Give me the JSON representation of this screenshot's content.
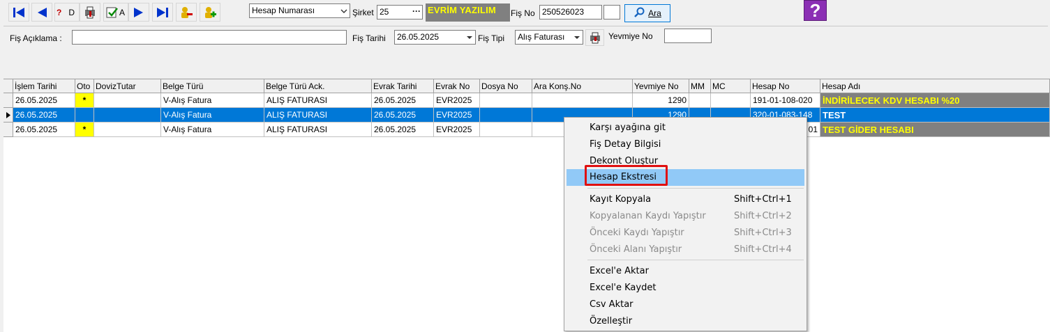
{
  "toolbar": {
    "icons": [
      "first-icon",
      "prev-icon",
      "query-icon",
      "print-preview-icon",
      "refresh-icon",
      "next-icon",
      "last-icon",
      "delete-user-icon",
      "add-user-icon"
    ],
    "partial_label_1": "D",
    "partial_label_2": "A"
  },
  "search": {
    "account_type": "Hesap Numarası",
    "company_label": "Şirket",
    "company_code": "25",
    "company_more": "···",
    "company_name": "EVRİM YAZILIM",
    "voucher_label": "Fiş No",
    "voucher_no": "250526023",
    "voucher_extra": "",
    "search_button": "Ara"
  },
  "form": {
    "description_label": "Fiş Açıklama :",
    "description_value": "",
    "date_label": "Fiş Tarihi",
    "date_value": "26.05.2025",
    "type_label": "Fiş  Tipi",
    "type_value": "Alış Faturası",
    "journal_label": "Yevmiye No",
    "journal_value": ""
  },
  "grid": {
    "columns": [
      "İşlem Tarihi",
      "Oto",
      "DovizTutar",
      "Belge Türü",
      "Belge Türü Ack.",
      "Evrak Tarihi",
      "Evrak No",
      "Dosya No",
      "Ara Konş.No",
      "Yevmiye No",
      "MM",
      "MC",
      "Hesap No",
      "Hesap Adı"
    ],
    "rows": [
      {
        "islem_tarihi": "26.05.2025",
        "oto": "*",
        "doviz": "",
        "belge_turu": "V-Alış Fatura",
        "belge_ack": "ALIŞ FATURASI",
        "evrak_tarihi": "26.05.2025",
        "evrak_no": "EVR2025",
        "dosya_no": "",
        "ara_kons": "",
        "yevmiye": "1290",
        "mm": "",
        "mc": "",
        "hesap_no": "191-01-108-020",
        "hesap_adi": "İNDİRİLECEK KDV HESABI %20"
      },
      {
        "islem_tarihi": "26.05.2025",
        "oto": "",
        "doviz": "",
        "belge_turu": "V-Alış Fatura",
        "belge_ack": "ALIŞ FATURASI",
        "evrak_tarihi": "26.05.2025",
        "evrak_no": "EVR2025",
        "dosya_no": "",
        "ara_kons": "",
        "yevmiye": "1290",
        "mm": "",
        "mc": "",
        "hesap_no": "320-01-083-148",
        "hesap_adi": "TEST"
      },
      {
        "islem_tarihi": "26.05.2025",
        "oto": "*",
        "doviz": "",
        "belge_turu": "V-Alış Fatura",
        "belge_ack": "ALIŞ FATURASI",
        "evrak_tarihi": "26.05.2025",
        "evrak_no": "EVR2025",
        "dosya_no": "",
        "ara_kons": "",
        "yevmiye": "",
        "mm": "",
        "mc": "",
        "hesap_no": "01",
        "hesap_adi": "TEST GİDER HESABI"
      }
    ]
  },
  "context_menu": {
    "items": [
      {
        "label": "Karşı ayağına git",
        "shortcut": "",
        "enabled": true
      },
      {
        "label": "Fiş Detay Bilgisi",
        "shortcut": "",
        "enabled": true
      },
      {
        "label": "Dekont Oluştur",
        "shortcut": "",
        "enabled": true
      },
      {
        "label": "Hesap Ekstresi",
        "shortcut": "",
        "enabled": true,
        "highlighted": true
      },
      {
        "label": "Kayıt Kopyala",
        "shortcut": "Shift+Ctrl+1",
        "enabled": true
      },
      {
        "label": "Kopyalanan Kaydı Yapıştır",
        "shortcut": "Shift+Ctrl+2",
        "enabled": false
      },
      {
        "label": "Önceki Kaydı Yapıştır",
        "shortcut": "Shift+Ctrl+3",
        "enabled": false
      },
      {
        "label": "Önceki Alanı Yapıştır",
        "shortcut": "Shift+Ctrl+4",
        "enabled": false
      },
      {
        "label": "Excel'e Aktar",
        "shortcut": "",
        "enabled": true
      },
      {
        "label": "Excel'e Kaydet",
        "shortcut": "",
        "enabled": true
      },
      {
        "label": "Csv Aktar",
        "shortcut": "",
        "enabled": true
      },
      {
        "label": "Özelleştir",
        "shortcut": "",
        "enabled": true
      }
    ]
  },
  "help": {
    "glyph": "?"
  },
  "colors": {
    "accent": "#0078d7",
    "highlight": "#91c9f7",
    "banner_bg": "#808080",
    "banner_fg": "#ffff00",
    "help_bg": "#8b2fb4",
    "annotation": "#e01010"
  }
}
